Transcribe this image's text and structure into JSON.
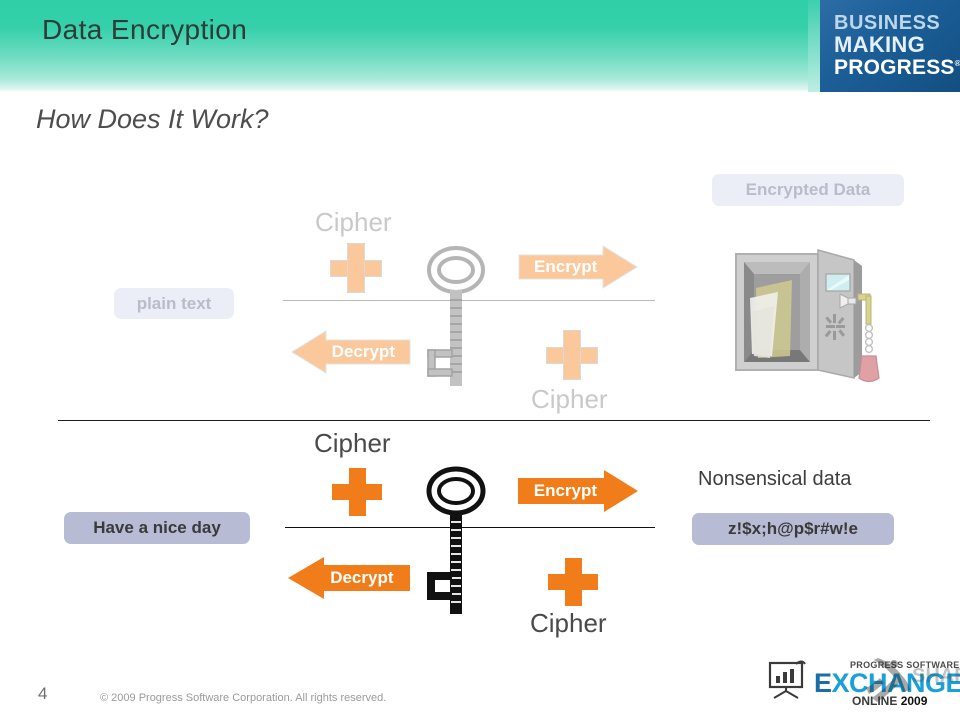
{
  "slide": {
    "title": "Data Encryption",
    "subtitle": "How Does It Work?",
    "number": "4",
    "copyright": "© 2009 Progress Software Corporation. All rights reserved."
  },
  "brand_logo": {
    "line1": "BUSINESS",
    "line2": "MAKING",
    "line3": "PROGRESS",
    "trademark": "®"
  },
  "event_logo": {
    "top_line": "PROGRESS SOFTWARE",
    "main_x": "E",
    "main_rest": "XCHANGE",
    "sub_label": "ONLINE",
    "sub_year": "2009",
    "icon": "presentation-board-icon"
  },
  "diagram_top": {
    "state": "ghosted",
    "input_label": "plain text",
    "cipher_top": "Cipher",
    "cipher_bottom": "Cipher",
    "encrypt_label": "Encrypt",
    "decrypt_label": "Decrypt",
    "output_label": "Encrypted Data",
    "key_icon": "skeleton-key-icon",
    "safe_icon": "open-safe-icon"
  },
  "diagram_bottom": {
    "state": "solid",
    "input_label": "Have a nice day",
    "cipher_top": "Cipher",
    "cipher_bottom": "Cipher",
    "encrypt_label": "Encrypt",
    "decrypt_label": "Decrypt",
    "output_caption": "Nonsensical data",
    "output_value": "z!$x;h@p$r#w!e",
    "key_icon": "skeleton-key-icon"
  },
  "colors": {
    "header_start": "#2FCFA8",
    "header_end": "#DFF6F0",
    "accent_orange": "#F07D1A",
    "accent_orange_ghost": "#FAC89A",
    "label_box": "#B7BBD4",
    "label_box_ghost": "#ECEEF7",
    "logo_blue": "#1D5F98",
    "event_cyan": "#1A9FD8"
  }
}
